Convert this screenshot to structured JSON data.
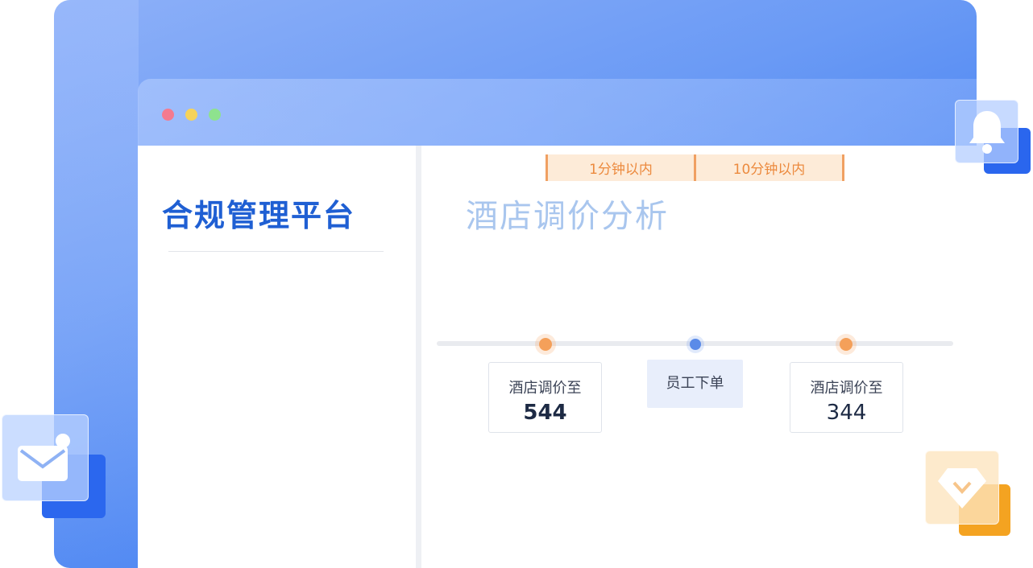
{
  "sidebar": {
    "title": "合规管理平台"
  },
  "main": {
    "title": "酒店调价分析"
  },
  "timeline": {
    "intervals": [
      "1分钟以内",
      "10分钟以内"
    ],
    "events": [
      {
        "label": "酒店调价至",
        "value": "544"
      },
      {
        "label": "员工下单"
      },
      {
        "label": "酒店调价至",
        "value": "344"
      }
    ]
  },
  "icons": {
    "window_controls": [
      "close-dot",
      "minimize-dot",
      "maximize-dot"
    ],
    "floating": [
      "bell-icon",
      "mail-icon",
      "diamond-icon"
    ]
  },
  "colors": {
    "brand_blue": "#1f5fd3",
    "accent_orange": "#ec8a3e",
    "title_light_blue": "#a9c6ee"
  }
}
